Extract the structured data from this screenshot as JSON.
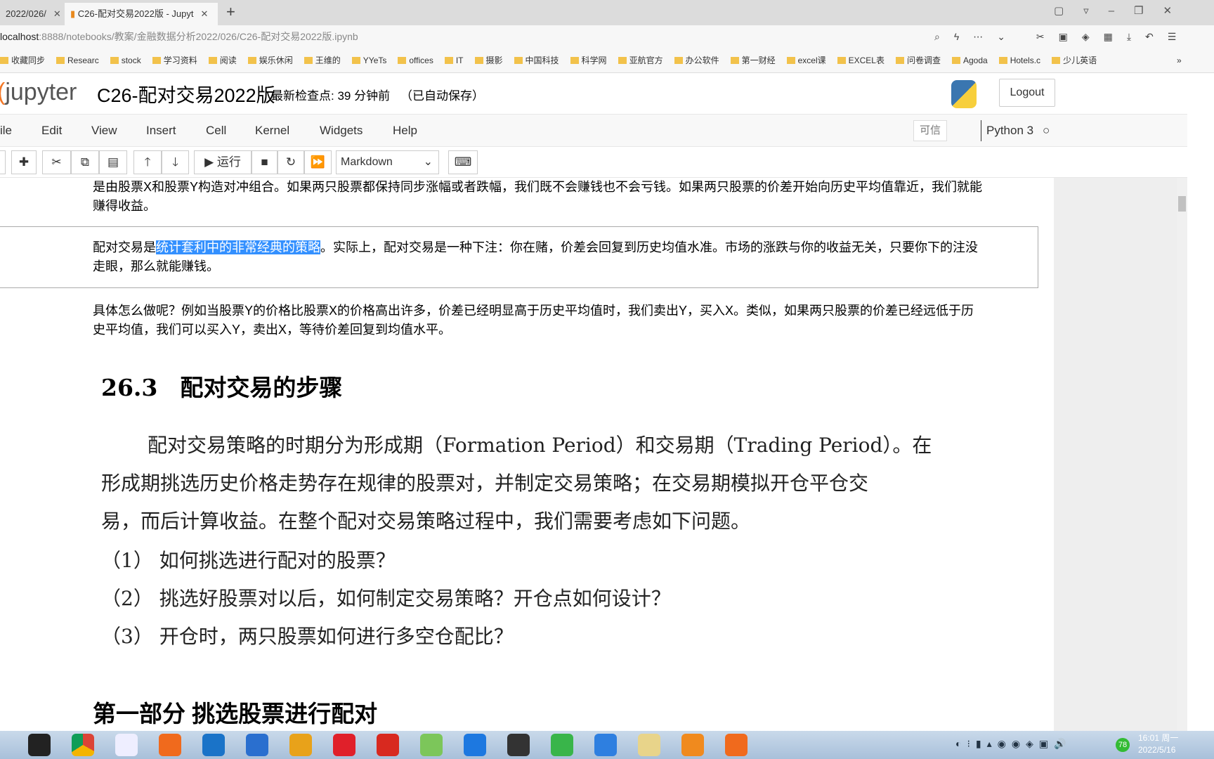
{
  "browser": {
    "tabs": [
      {
        "label": "2022/026/"
      },
      {
        "label": "C26-配对交易2022版 - Jupyt"
      }
    ],
    "new_tab": "+",
    "address_host": "localhost",
    "address_rest": ":8888/notebooks/教案/金融数据分析2022/026/C26-配对交易2022版.ipynb",
    "bookmarks": [
      "收藏同步",
      "Researc",
      "stock",
      "学习资料",
      "阅读",
      "娱乐休闲",
      "王维的",
      "YYeTs",
      "offices",
      "IT",
      "摄影",
      "中国科技",
      "科学网",
      "亚航官方",
      "办公软件",
      "第一财经",
      "excel课",
      "EXCEL表",
      "问卷调查",
      "Agoda",
      "Hotels.c",
      "少儿英语"
    ],
    "more": "»"
  },
  "jupyter": {
    "logo": "jupyter",
    "title": "C26-配对交易2022版",
    "checkpoint": "最新检查点: 39 分钟前",
    "autosave": "（已自动保存）",
    "logout": "Logout",
    "menu": [
      "ile",
      "Edit",
      "View",
      "Insert",
      "Cell",
      "Kernel",
      "Widgets",
      "Help"
    ],
    "trusted": "可信",
    "kernel": "Python 3",
    "run_label": "运行",
    "cell_type": "Markdown"
  },
  "cells": {
    "p1_line1": "是由股票X和股票Y构造对冲组合。如果两只股票都保持同步涨幅或者跌幅，我们既不会赚钱也不会亏钱。如果两只股票的价差开始向历史平均值靠近，我们就能",
    "p1_line2": "赚得收益。",
    "p2_pre": "配对交易是",
    "p2_sel": "统计套利中的非常经典的策略",
    "p2_post": "。实际上，配对交易是一种下注：你在赌，价差会回复到历史均值水准。市场的涨跌与你的收益无关，只要你下的注没",
    "p2_line2": "走眼，那么就能赚钱。",
    "p3_line1": "具体怎么做呢？例如当股票Y的价格比股票X的价格高出许多，价差已经明显高于历史平均值时，我们卖出Y，买入X。类似，如果两只股票的价差已经远低于历",
    "p3_line2": "史平均值，我们可以买入Y，卖出X，等待价差回复到均值水平。",
    "heading_num": "26.3",
    "heading": "配对交易的步骤",
    "body1": "配对交易策略的时期分为形成期（Formation Period）和交易期（Trading Period）。在",
    "body2": "形成期挑选历史价格走势存在规律的股票对，并制定交易策略；在交易期模拟开仓平仓交",
    "body3": "易，而后计算收益。在整个配对交易策略过程中，我们需要考虑如下问题。",
    "q1": "（1）  如何挑选进行配对的股票？",
    "q2": "（2）  挑选好股票对以后，如何制定交易策略？开仓点如何设计？",
    "q3": "（3）  开仓时，两只股票如何进行多空仓配比？",
    "part1": "第一部分 挑选股票进行配对"
  },
  "taskbar": {
    "time": "16:01 周一",
    "date": "2022/5/16",
    "badge": "78"
  }
}
